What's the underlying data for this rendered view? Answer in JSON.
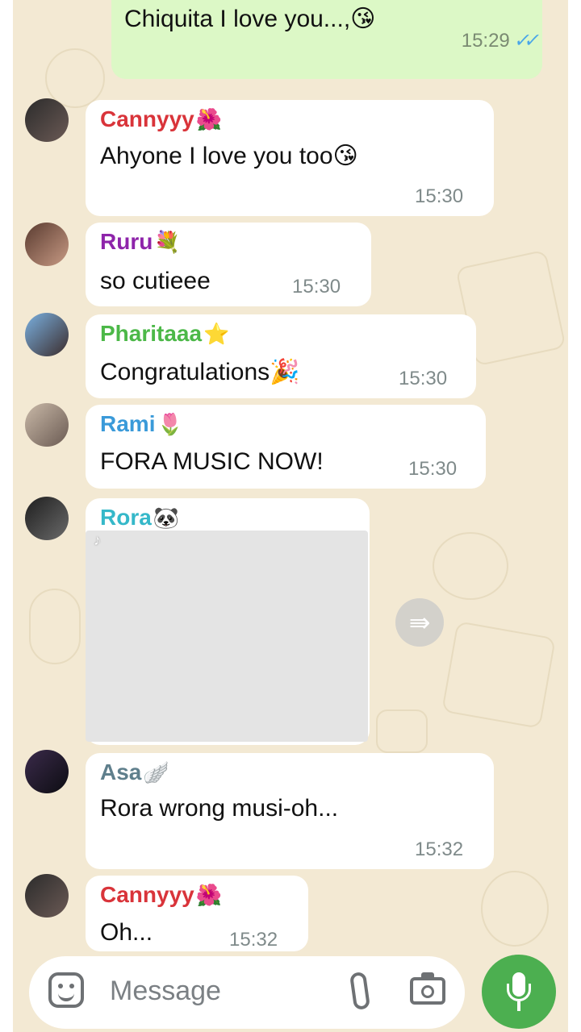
{
  "outgoing": {
    "text": "Chiquita I love you...,😘",
    "time": "15:29"
  },
  "messages": [
    {
      "name": "Cannyyy",
      "emoji": "🌺",
      "name_color": "#d9343a",
      "text": "Ahyone I love you too😘",
      "time": "15:30"
    },
    {
      "name": "Ruru",
      "emoji": "💐",
      "name_color": "#8e24aa",
      "text": "so cutieee",
      "time": "15:30"
    },
    {
      "name": "Pharitaaa",
      "emoji": "⭐",
      "name_color": "#4cb848",
      "text": "Congratulations🎉",
      "time": "15:30"
    },
    {
      "name": "Rami",
      "emoji": "🌷",
      "name_color": "#3a9ad9",
      "text": "FORA MUSIC NOW!",
      "time": "15:30"
    },
    {
      "name": "Rora",
      "emoji": "🐼",
      "name_color": "#35b8c9",
      "text": "",
      "time": ""
    },
    {
      "name": "Asa",
      "emoji": "🪽",
      "name_color": "#5f7f8c",
      "text": "Rora wrong musi-oh...",
      "time": "15:32"
    },
    {
      "name": "Cannyyy",
      "emoji": "🌺",
      "name_color": "#d9343a",
      "text": "Oh...",
      "time": "15:32"
    }
  ],
  "composer": {
    "placeholder": "Message"
  },
  "icons": {
    "sticker": "sticker-icon",
    "attach": "paperclip-icon",
    "camera": "camera-icon",
    "mic": "microphone-icon",
    "forward": "forward-icon",
    "read": "double-check-icon"
  }
}
